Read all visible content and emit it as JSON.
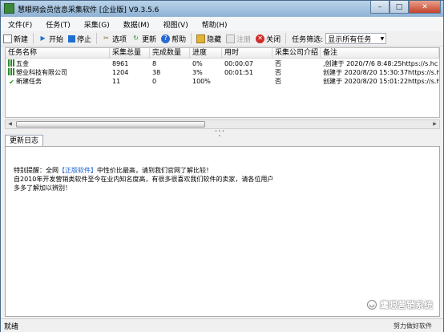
{
  "window": {
    "title": "慧眼网会员信息采集软件 [企业版] V9.3.5.6",
    "minimize": "–",
    "maximize": "□",
    "close": "✕"
  },
  "menu": [
    "文件(F)",
    "任务(T)",
    "采集(G)",
    "数据(M)",
    "视图(V)",
    "帮助(H)"
  ],
  "toolbar": {
    "new": "新建",
    "start": "开始",
    "stop": "停止",
    "options": "选项",
    "refresh": "更新",
    "help": "帮助",
    "hide": "隐藏",
    "register": "注册",
    "close": "关闭",
    "filter_label": "任务筛选:",
    "filter_value": "显示所有任务"
  },
  "table": {
    "columns": [
      "任务名称",
      "采集总量",
      "完成数量",
      "进度",
      "用时",
      "采集公司介绍",
      "备注"
    ],
    "rows": [
      {
        "name": "五金",
        "total": "8961",
        "done": "8",
        "progress": "0%",
        "time": "00:00:07",
        "intro": "否",
        "note": ",创建于 2020/7/6 8:48:25https://s.hc",
        "icon": "bars"
      },
      {
        "name": "塑业科技有限公司",
        "total": "1204",
        "done": "38",
        "progress": "3%",
        "time": "00:01:51",
        "intro": "否",
        "note": "创建于 2020/8/20 15:30:37https://s.hc",
        "icon": "bars"
      },
      {
        "name": "新建任务",
        "total": "11",
        "done": "0",
        "progress": "100%",
        "time": "",
        "intro": "否",
        "note": "创建于 2020/8/20 15:01:22https://s.hc",
        "icon": "check"
      }
    ]
  },
  "log": {
    "tab_label": "更新日志",
    "line1_prefix": "特别提醒：全网",
    "line1_highlight": "【正版软件】",
    "line1_suffix": "中性价比最高，请到我们官网了解比较！",
    "line2": "自2010年开发营销类软件至今在业内知名度高，有很多很喜欢我们软件的卖家，请各位用户",
    "line3": "多多了解加以辨别！"
  },
  "watermark": "鹰眼营销系统",
  "status": {
    "left": "就绪",
    "right": "努力做好软件"
  }
}
